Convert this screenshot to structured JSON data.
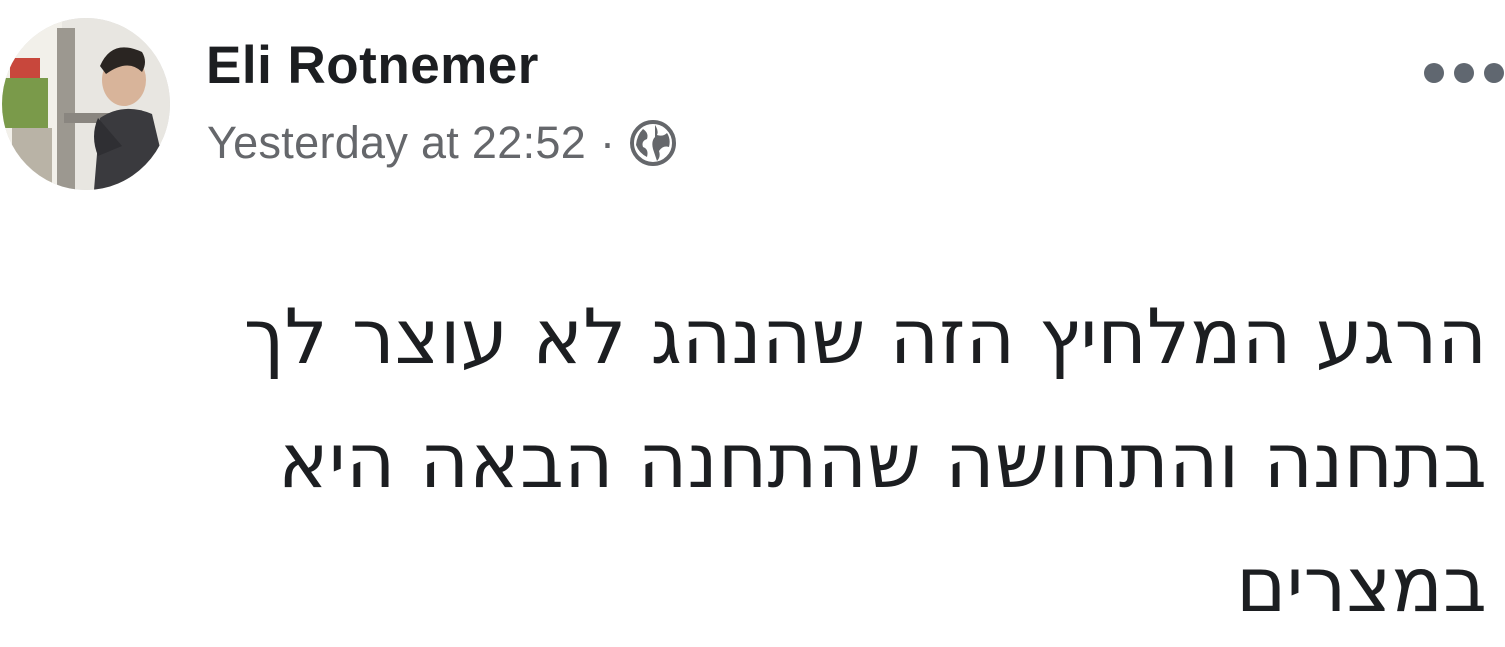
{
  "post": {
    "author": {
      "name": "Eli Rotnemer",
      "avatar_icon": "profile-photo"
    },
    "meta": {
      "timestamp": "Yesterday at 22:52",
      "separator": "·",
      "privacy_icon": "globe-icon"
    },
    "menu_icon": "more-horizontal-icon",
    "text_lines": [
      "הרגע המלחיץ הזה שהנהג לא עוצר לך",
      "בתחנה והתחושה שהתחנה הבאה היא",
      "במצרים"
    ]
  },
  "colors": {
    "text_primary": "#1c1e21",
    "text_secondary": "#65676b",
    "icon_gray": "#606770",
    "background": "#ffffff"
  }
}
